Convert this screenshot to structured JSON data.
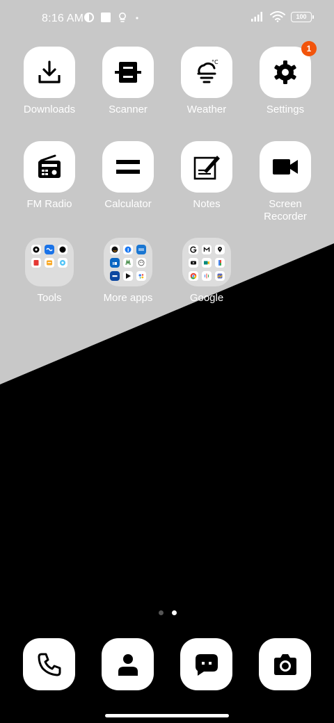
{
  "status_bar": {
    "time": "8:16 AM",
    "battery": "100"
  },
  "apps": {
    "downloads": {
      "label": "Downloads"
    },
    "scanner": {
      "label": "Scanner"
    },
    "weather": {
      "label": "Weather",
      "unit": "°C"
    },
    "settings": {
      "label": "Settings",
      "badge": "1"
    },
    "fm_radio": {
      "label": "FM Radio"
    },
    "calculator": {
      "label": "Calculator"
    },
    "notes": {
      "label": "Notes"
    },
    "screen_recorder": {
      "label": "Screen Recorder"
    }
  },
  "folders": {
    "tools": {
      "label": "Tools"
    },
    "more_apps": {
      "label": "More apps"
    },
    "google": {
      "label": "Google"
    }
  },
  "colors": {
    "wallpaper_light": "#c8c8c8",
    "wallpaper_dark": "#000000",
    "badge": "#f2540b"
  },
  "page_indicator": {
    "pages": 2,
    "current": 2
  }
}
